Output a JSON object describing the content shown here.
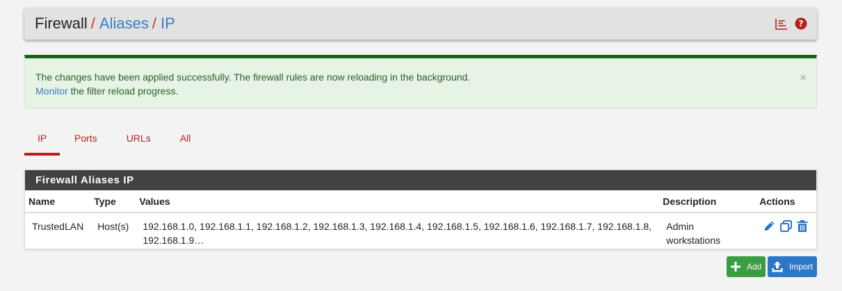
{
  "breadcrumb": {
    "root": "Firewall",
    "separator": "/",
    "aliases": "Aliases",
    "current": "IP"
  },
  "header_icons": [
    "related-chart-icon",
    "help-icon"
  ],
  "alert": {
    "line1": "The changes have been applied successfully. The firewall rules are now reloading in the background.",
    "link": "Monitor",
    "line2_rest": " the filter reload progress.",
    "close": "×"
  },
  "tabs": [
    {
      "label": "IP",
      "active": true
    },
    {
      "label": "Ports",
      "active": false
    },
    {
      "label": "URLs",
      "active": false
    },
    {
      "label": "All",
      "active": false
    }
  ],
  "panel": {
    "title": "Firewall Aliases IP",
    "columns": [
      "Name",
      "Type",
      "Values",
      "Description",
      "Actions"
    ],
    "rows": [
      {
        "name": "TrustedLAN",
        "type": "Host(s)",
        "values": "192.168.1.0, 192.168.1.1, 192.168.1.2, 192.168.1.3, 192.168.1.4, 192.168.1.5, 192.168.1.6, 192.168.1.7, 192.168.1.8, 192.168.1.9…",
        "description": "Admin workstations",
        "actions": [
          "edit-icon",
          "copy-icon",
          "delete-icon"
        ]
      }
    ]
  },
  "buttons": {
    "add": "Add",
    "import": "Import"
  },
  "colors": {
    "accent_red": "#b5201c",
    "link_blue": "#3a7ec3",
    "success_green": "#1c5e1e",
    "add_green": "#3a9d41",
    "import_blue": "#2c77c8"
  }
}
